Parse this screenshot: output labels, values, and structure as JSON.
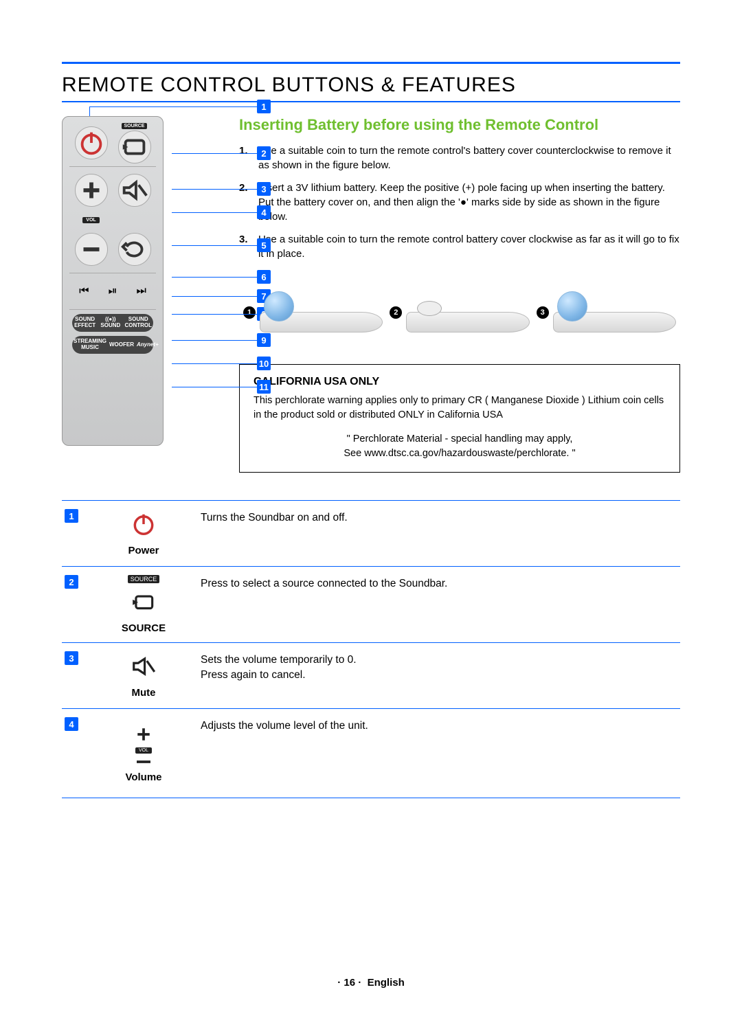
{
  "title": "REMOTE CONTROL BUTTONS & FEATURES",
  "subtitle": "Inserting Battery before using the Remote Control",
  "steps": [
    {
      "n": "1.",
      "t": "Use a suitable coin to turn the remote control's battery cover counterclockwise to remove it as shown in the figure below."
    },
    {
      "n": "2.",
      "t": "Insert a 3V lithium battery. Keep the positive (+) pole facing up when inserting the battery. Put the battery cover on, and then align the '●' marks side by side as shown in the figure below."
    },
    {
      "n": "3.",
      "t": "Use a suitable coin to turn the remote control battery cover clockwise as far as it will go to fix it in place."
    }
  ],
  "fig_nums": [
    "1",
    "2",
    "3"
  ],
  "california": {
    "title": "CALIFORNIA USA ONLY",
    "body": "This perchlorate warning applies only to primary CR ( Manganese Dioxide ) Lithium coin cells in the product sold or distributed ONLY in California USA",
    "quote1": "\" Perchlorate Material - special handling may apply,",
    "quote2": "See www.dtsc.ca.gov/hazardouswaste/perchlorate. \""
  },
  "callouts": [
    "1",
    "2",
    "3",
    "4",
    "5",
    "6",
    "7",
    "8",
    "9",
    "10",
    "11"
  ],
  "remote_labels": {
    "source": "SOURCE",
    "vol": "VOL",
    "sound_effect": "SOUND EFFECT",
    "surround": "((●)) SOUND",
    "sound_control": "SOUND CONTROL",
    "streaming": "STREAMING MUSIC",
    "woofer": "WOOFER",
    "anynet": "Anynet+"
  },
  "table": [
    {
      "n": "1",
      "label": "Power",
      "desc": "Turns the Soundbar on and off."
    },
    {
      "n": "2",
      "label": "SOURCE",
      "desc": "Press to select a source connected to the Soundbar."
    },
    {
      "n": "3",
      "label": "Mute",
      "desc": "Sets the volume temporarily to 0.\nPress again to cancel."
    },
    {
      "n": "4",
      "label": "Volume",
      "desc": "Adjusts the volume level of the unit."
    }
  ],
  "footer": {
    "page": "16",
    "lang": "English"
  }
}
